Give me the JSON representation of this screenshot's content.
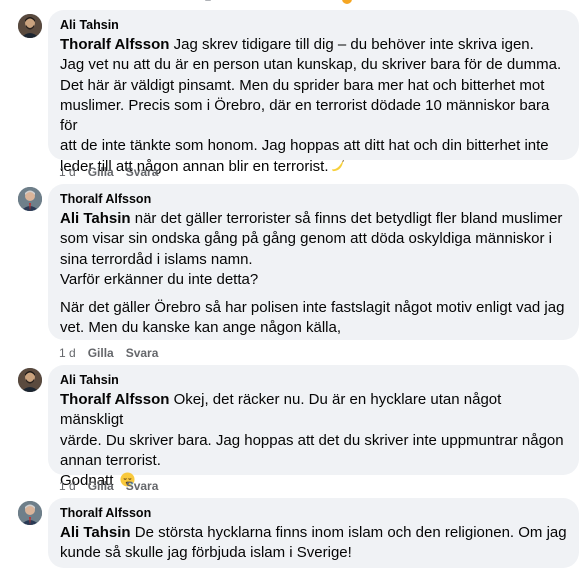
{
  "comments": [
    {
      "author": "Ali Tahsin",
      "mention": "Thoralf Alfsson",
      "paragraphs": [
        " Jag skrev tidigare till dig – du behöver inte skriva igen.",
        "Jag vet nu att du är en person utan kunskap, du skriver bara för de dumma.",
        "Det här är väldigt pinsamt. Men du sprider bara mer hat och bitterhet mot",
        "muslimer. Precis som i Örebro, där en terrorist dödade 10 människor bara för",
        "att de inte tänkte som honom. Jag hoppas att ditt hat och din bitterhet inte",
        "leder till att någon annan blir en terrorist."
      ],
      "emoji": "banana-icon",
      "time": "1 d",
      "like": "Gilla",
      "reply": "Svara"
    },
    {
      "author": "Thoralf Alfsson",
      "mention": "Ali Tahsin",
      "line1_rest": " när det gäller terrorister så finns det betydligt fler bland muslimer",
      "line2": "som visar sin ondska gång på gång genom att döda oskyldiga människor i",
      "line3": "sina terrordåd i islams namn.",
      "line4": "Varför erkänner du inte detta?",
      "para2_line1": "När det gäller Örebro så har polisen inte fastslagit något motiv enligt vad jag",
      "para2_line2": "vet. Men du kanske kan ange någon källa,",
      "time": "1 d",
      "like": "Gilla",
      "reply": "Svara"
    },
    {
      "author": "Ali Tahsin",
      "mention": "Thoralf Alfsson",
      "line1_rest": " Okej, det räcker nu. Du är en hycklare utan något mänskligt",
      "line2": "värde. Du skriver bara. Jag hoppas att det du skriver inte uppmuntrar någon",
      "line3": "annan terrorist.",
      "line4": "Godnatt",
      "emoji": "sleeping-face-icon",
      "time": "1 d",
      "like": "Gilla",
      "reply": "Svara"
    },
    {
      "author": "Thoralf Alfsson",
      "mention": "Ali Tahsin",
      "line1_rest": " De största hycklarna finns inom islam och den religionen. Om jag",
      "line2": "kunde så skulle jag förbjuda islam i Sverige!"
    }
  ],
  "colors": {
    "bubble": "#f0f2f5",
    "text": "#050505",
    "meta": "#65676b"
  }
}
